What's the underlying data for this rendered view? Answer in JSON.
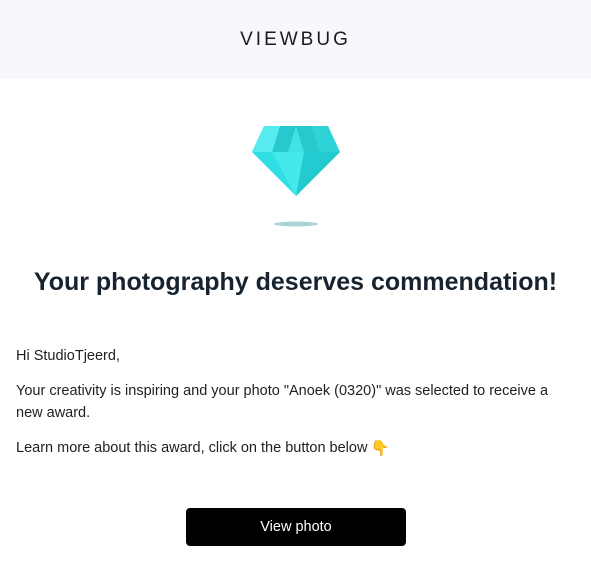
{
  "header": {
    "brand": "VIEWBUG"
  },
  "hero": {
    "icon": "diamond-icon",
    "color": "#2ee6e6"
  },
  "headline": "Your photography deserves commendation!",
  "message": {
    "greeting": "Hi StudioTjeerd,",
    "paragraph1": "Your creativity is inspiring and your photo \"Anoek (0320)\" was selected to receive a new award.",
    "paragraph2": "Learn more about this award, click on the button below",
    "paragraph2_icon": "pointing-down-hand-icon"
  },
  "cta": {
    "label": "View photo"
  }
}
